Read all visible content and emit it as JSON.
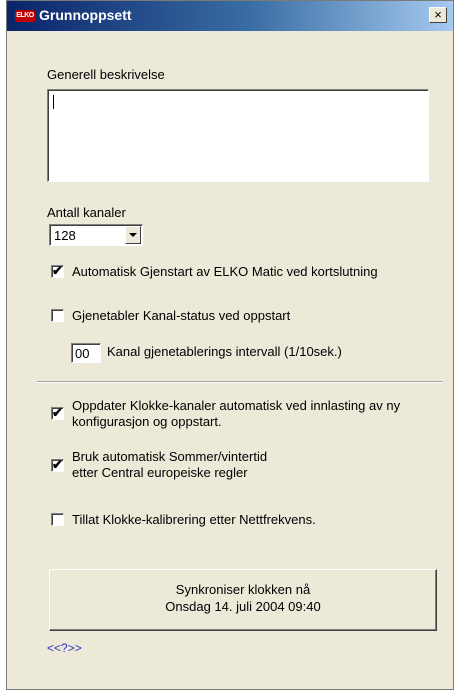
{
  "window": {
    "title": "Grunnoppsett",
    "icon_label": "ELKO",
    "close_symbol": "×"
  },
  "description": {
    "label": "Generell beskrivelse",
    "value": ""
  },
  "channels": {
    "label": "Antall kanaler",
    "selected": "128"
  },
  "checkboxes": {
    "auto_restart": {
      "label": "Automatisk Gjenstart av ELKO Matic ved kortslutning",
      "checked": true
    },
    "restore_status": {
      "label": "Gjenetabler Kanal-status ved oppstart",
      "checked": false
    },
    "update_clock": {
      "line1": "Oppdater Klokke-kanaler automatisk ved innlasting av ny",
      "line2": "konfigurasjon og oppstart.",
      "checked": true
    },
    "dst": {
      "line1": "Bruk automatisk Sommer/vintertid",
      "line2": "etter Central europeiske regler",
      "checked": true
    },
    "calibration": {
      "label": "Tillat Klokke-kalibrering etter Nettfrekvens.",
      "checked": false
    }
  },
  "interval": {
    "value": "00",
    "label": "Kanal gjenetablerings intervall (1/10sek.)"
  },
  "sync_button": {
    "line1": "Synkroniser klokken nå",
    "line2": "Onsdag  14. juli 2004  09:40"
  },
  "help_link": "<<?>>",
  "check_glyph": "✔"
}
